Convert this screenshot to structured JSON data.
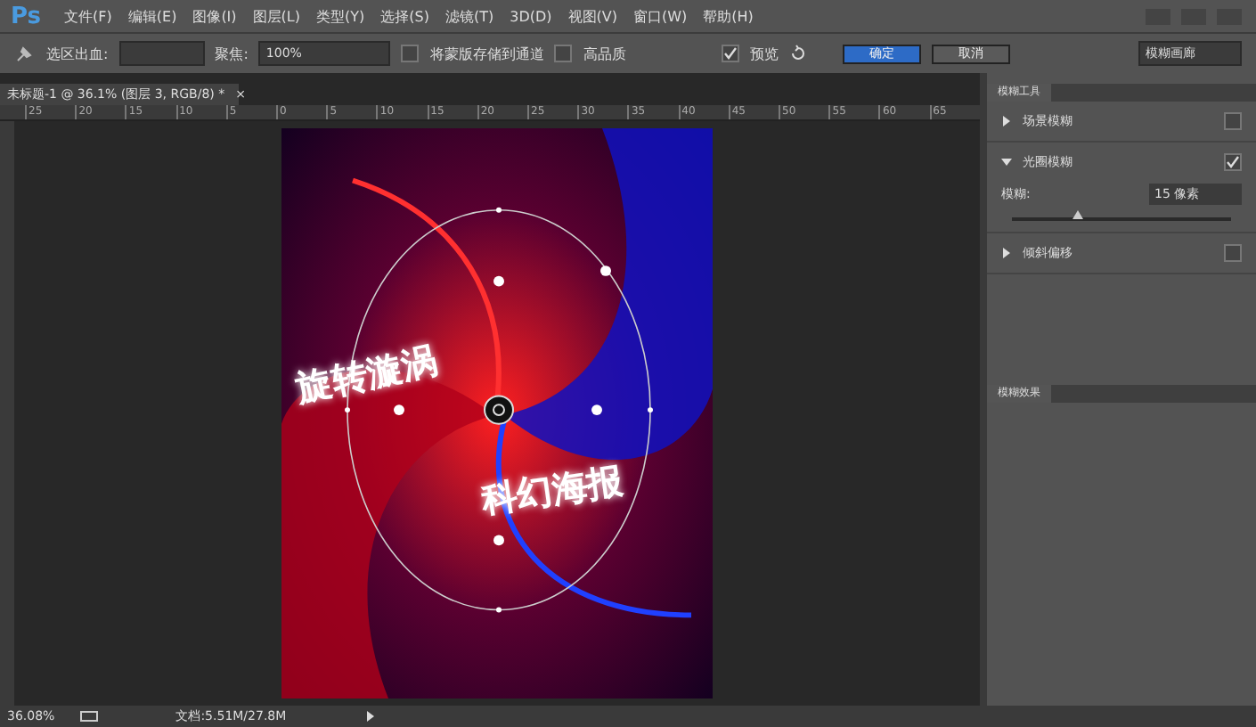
{
  "app": {
    "logo": "Ps"
  },
  "menu": [
    "文件(F)",
    "编辑(E)",
    "图像(I)",
    "图层(L)",
    "类型(Y)",
    "选择(S)",
    "滤镜(T)",
    "3D(D)",
    "视图(V)",
    "窗口(W)",
    "帮助(H)"
  ],
  "options": {
    "bleed_label": "选区出血:",
    "focus_label": "聚焦:",
    "focus_value": "100%",
    "checks": [
      {
        "label": "将蒙版存储到通道",
        "checked": false
      },
      {
        "label": "高品质",
        "checked": false
      }
    ],
    "preview": {
      "label": "预览",
      "checked": true
    },
    "ok": "确定",
    "cancel": "取消",
    "workspace": "模糊画廊"
  },
  "document_tab": {
    "title": "未标题-1 @ 36.1% (图层 3, RGB/8) *",
    "close": "×"
  },
  "ruler": [
    "25",
    "20",
    "15",
    "10",
    "5",
    "0",
    "5",
    "10",
    "15",
    "20",
    "25",
    "30",
    "35",
    "40",
    "45",
    "50",
    "55",
    "60",
    "65"
  ],
  "poster": {
    "texts": [
      "旋转漩涡",
      "科幻海报"
    ]
  },
  "panel": {
    "title": "模糊工具",
    "tools": [
      {
        "name": "场景模糊",
        "expanded": false,
        "checked": false
      },
      {
        "name": "光圈模糊",
        "expanded": true,
        "checked": true,
        "param_label": "模糊:",
        "param_value": "15 像素",
        "level": 0.3
      },
      {
        "name": "倾斜偏移",
        "expanded": false,
        "checked": false
      }
    ],
    "effects_title": "模糊效果"
  },
  "status": {
    "zoom": "36.08%",
    "doc": "文档:5.51M/27.8M"
  }
}
